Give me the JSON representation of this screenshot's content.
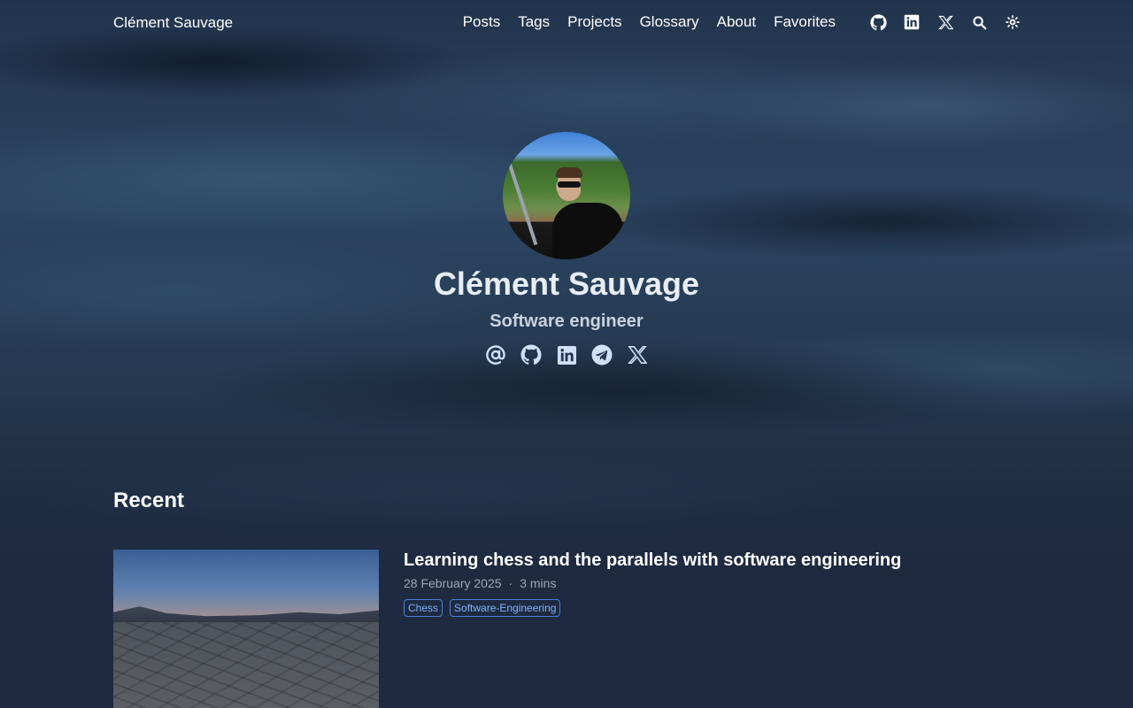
{
  "nav": {
    "brand": "Clément Sauvage",
    "items": [
      {
        "label": "Posts"
      },
      {
        "label": "Tags"
      },
      {
        "label": "Projects"
      },
      {
        "label": "Glossary"
      },
      {
        "label": "About"
      },
      {
        "label": "Favorites"
      }
    ],
    "icons": [
      "github-icon",
      "linkedin-icon",
      "x-icon",
      "search-icon",
      "theme-toggle-icon"
    ]
  },
  "hero": {
    "name": "Clément Sauvage",
    "role": "Software engineer",
    "social_icons": [
      "email-icon",
      "github-icon",
      "linkedin-icon",
      "telegram-icon",
      "x-icon"
    ]
  },
  "recent": {
    "title": "Recent",
    "posts": [
      {
        "title": "Learning chess and the parallels with software engineering",
        "date": "28 February 2025",
        "separator": "·",
        "read_time": "3 mins",
        "tags": [
          "Chess",
          "Software-Engineering"
        ]
      }
    ]
  },
  "colors": {
    "background": "#1d2a3f",
    "tag_accent": "#7fb3ff",
    "meta_text": "#9aa8b8",
    "social_icon": "#cfe0f7"
  }
}
